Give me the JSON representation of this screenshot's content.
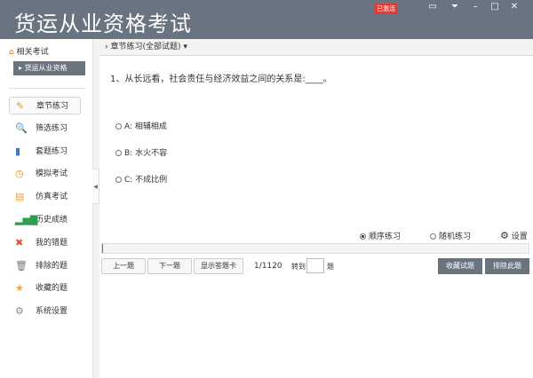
{
  "header": {
    "title": "货运从业资格考试",
    "activated_badge": "已激活",
    "window_buttons": [
      "feedback-icon",
      "menu-icon",
      "minimize-icon",
      "maximize-icon",
      "close-icon"
    ]
  },
  "sidebar": {
    "related_label": "相关考试",
    "current_exam": "货运从业资格",
    "items": [
      {
        "label": "章节练习",
        "icon": "pencil-icon",
        "glyph": "✎",
        "color": "#e0a020"
      },
      {
        "label": "筛选练习",
        "icon": "search-icon",
        "glyph": "🔍",
        "color": "#4a7fb5"
      },
      {
        "label": "套题练习",
        "icon": "books-icon",
        "glyph": "▮",
        "color": "#3a78c2"
      },
      {
        "label": "模拟考试",
        "icon": "clock-icon",
        "glyph": "◷",
        "color": "#f08a00"
      },
      {
        "label": "仿真考试",
        "icon": "notepad-icon",
        "glyph": "▤",
        "color": "#d9a441"
      },
      {
        "label": "历史成绩",
        "icon": "bar-chart-icon",
        "glyph": "▂▅▇",
        "color": "#2e9e4f"
      },
      {
        "label": "我的错题",
        "icon": "x-icon",
        "glyph": "✖",
        "color": "#e0522a"
      },
      {
        "label": "排除的题",
        "icon": "trash-icon",
        "glyph": "🗑",
        "color": "#777777"
      },
      {
        "label": "收藏的题",
        "icon": "star-icon",
        "glyph": "★",
        "color": "#f5a623"
      },
      {
        "label": "系统设置",
        "icon": "gear-icon",
        "glyph": "⚙",
        "color": "#7a8aa0"
      }
    ]
  },
  "breadcrumb": {
    "label": "章节练习(全部试题)"
  },
  "question": {
    "text": "1、从长远看，社会责任与经济效益之间的关系是:____。",
    "options": [
      "A: 相辅相成",
      "B: 水火不容",
      "C: 不成比例"
    ]
  },
  "modes": {
    "sequential": "顺序练习",
    "random": "随机练习",
    "settings": "设置",
    "selected": "sequential"
  },
  "progress": {
    "current": 1,
    "total": 1120,
    "fraction": 0.0009
  },
  "footer": {
    "prev": "上一题",
    "next": "下一题",
    "show_card": "显示答题卡",
    "counter": "1/1120",
    "goto_label": "转到",
    "goto_value": "",
    "goto_suffix": "题",
    "favorite": "收藏试题",
    "exclude": "排除此题"
  }
}
